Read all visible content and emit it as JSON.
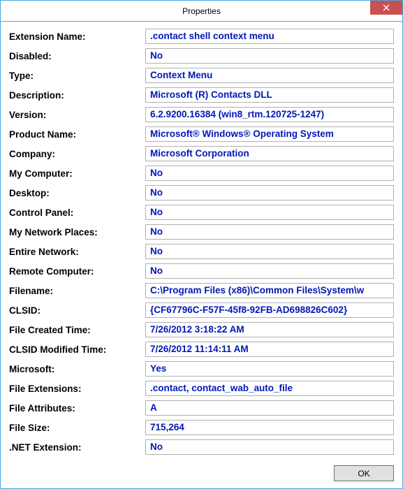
{
  "window": {
    "title": "Properties",
    "close_label": "Close"
  },
  "fields": [
    {
      "label": "Extension Name:",
      "value": ".contact shell context menu"
    },
    {
      "label": "Disabled:",
      "value": "No"
    },
    {
      "label": "Type:",
      "value": "Context Menu"
    },
    {
      "label": "Description:",
      "value": "Microsoft (R) Contacts DLL"
    },
    {
      "label": "Version:",
      "value": "6.2.9200.16384 (win8_rtm.120725-1247)"
    },
    {
      "label": "Product Name:",
      "value": "Microsoft® Windows® Operating System"
    },
    {
      "label": "Company:",
      "value": "Microsoft Corporation"
    },
    {
      "label": "My Computer:",
      "value": "No"
    },
    {
      "label": "Desktop:",
      "value": "No"
    },
    {
      "label": "Control Panel:",
      "value": "No"
    },
    {
      "label": "My Network Places:",
      "value": "No"
    },
    {
      "label": "Entire Network:",
      "value": "No"
    },
    {
      "label": "Remote Computer:",
      "value": "No"
    },
    {
      "label": "Filename:",
      "value": "C:\\Program Files (x86)\\Common Files\\System\\w"
    },
    {
      "label": "CLSID:",
      "value": "{CF67796C-F57F-45f8-92FB-AD698826C602}"
    },
    {
      "label": "File Created Time:",
      "value": "7/26/2012 3:18:22 AM"
    },
    {
      "label": "CLSID Modified Time:",
      "value": "7/26/2012 11:14:11 AM"
    },
    {
      "label": "Microsoft:",
      "value": "Yes"
    },
    {
      "label": "File Extensions:",
      "value": ".contact, contact_wab_auto_file"
    },
    {
      "label": "File Attributes:",
      "value": "A"
    },
    {
      "label": "File Size:",
      "value": "715,264"
    },
    {
      "label": ".NET Extension:",
      "value": "No"
    }
  ],
  "footer": {
    "ok_label": "OK"
  }
}
